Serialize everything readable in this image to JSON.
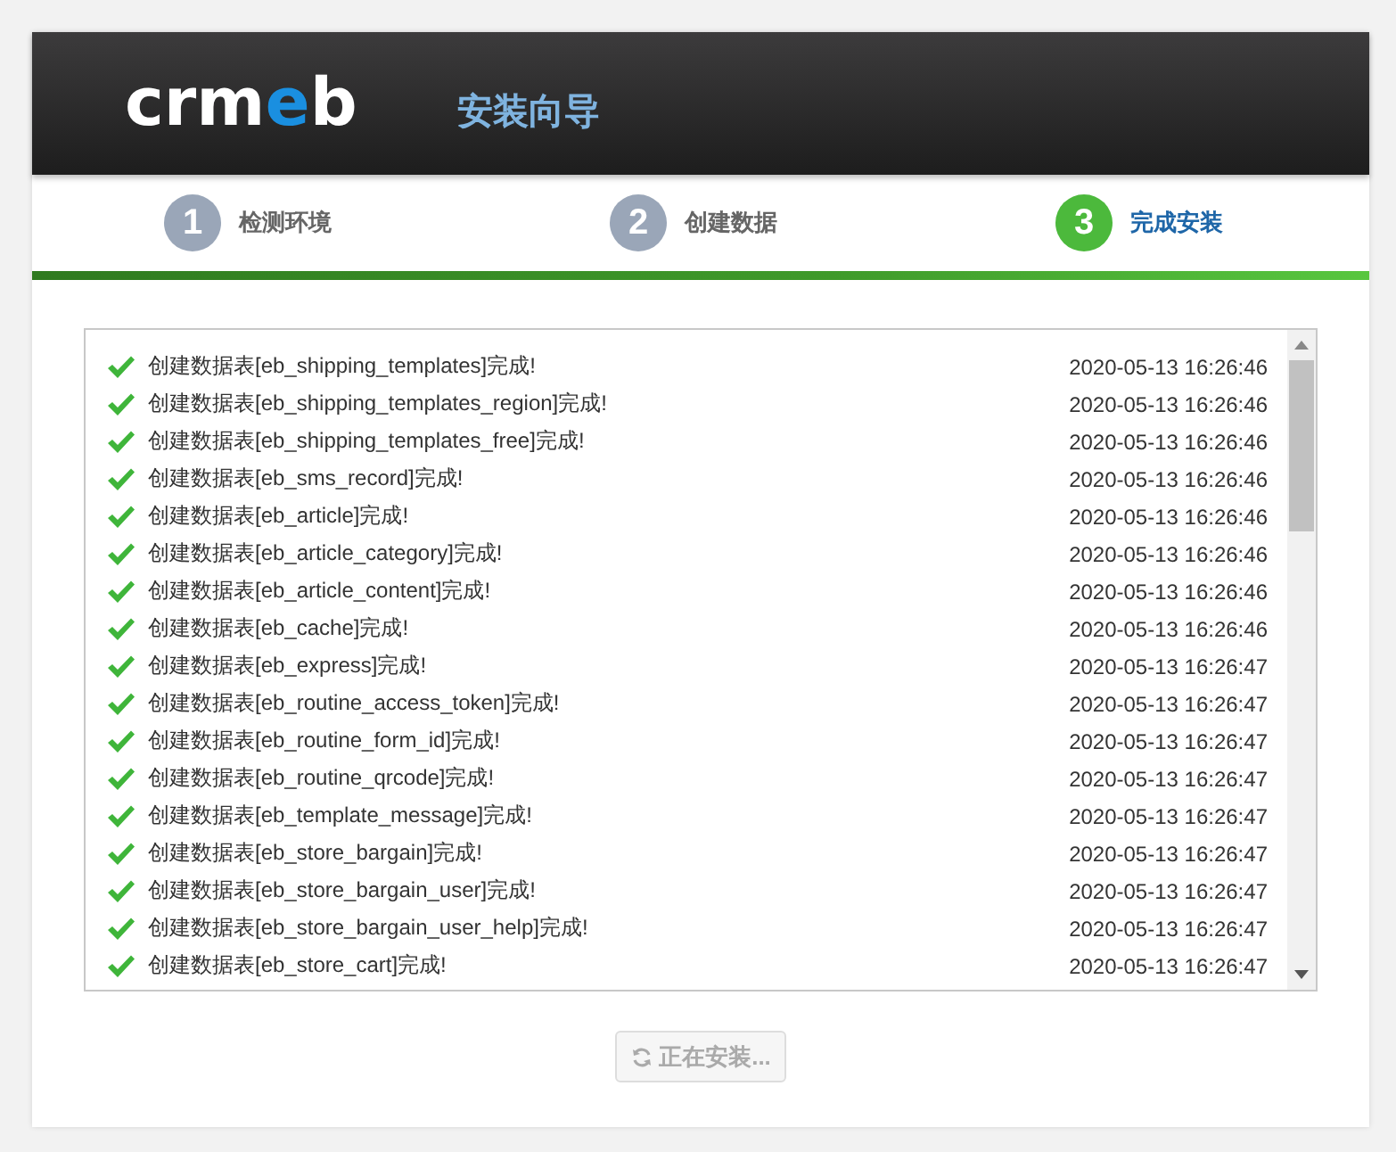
{
  "header": {
    "logo": [
      {
        "text": "crm",
        "accent": false
      },
      {
        "text": "e",
        "accent": true
      },
      {
        "text": "b",
        "accent": false
      }
    ],
    "title": "安装向导"
  },
  "steps": [
    {
      "number": "1",
      "label": "检测环境",
      "selected": false
    },
    {
      "number": "2",
      "label": "创建数据",
      "selected": false
    },
    {
      "number": "3",
      "label": "完成安装",
      "selected": true
    }
  ],
  "progress": {
    "level": 1
  },
  "log": [
    {
      "message": "创建数据表[eb_shipping_templates]完成!",
      "time": "2020-05-13 16:26:46"
    },
    {
      "message": "创建数据表[eb_shipping_templates_region]完成!",
      "time": "2020-05-13 16:26:46"
    },
    {
      "message": "创建数据表[eb_shipping_templates_free]完成!",
      "time": "2020-05-13 16:26:46"
    },
    {
      "message": "创建数据表[eb_sms_record]完成!",
      "time": "2020-05-13 16:26:46"
    },
    {
      "message": "创建数据表[eb_article]完成!",
      "time": "2020-05-13 16:26:46"
    },
    {
      "message": "创建数据表[eb_article_category]完成!",
      "time": "2020-05-13 16:26:46"
    },
    {
      "message": "创建数据表[eb_article_content]完成!",
      "time": "2020-05-13 16:26:46"
    },
    {
      "message": "创建数据表[eb_cache]完成!",
      "time": "2020-05-13 16:26:46"
    },
    {
      "message": "创建数据表[eb_express]完成!",
      "time": "2020-05-13 16:26:47"
    },
    {
      "message": "创建数据表[eb_routine_access_token]完成!",
      "time": "2020-05-13 16:26:47"
    },
    {
      "message": "创建数据表[eb_routine_form_id]完成!",
      "time": "2020-05-13 16:26:47"
    },
    {
      "message": "创建数据表[eb_routine_qrcode]完成!",
      "time": "2020-05-13 16:26:47"
    },
    {
      "message": "创建数据表[eb_template_message]完成!",
      "time": "2020-05-13 16:26:47"
    },
    {
      "message": "创建数据表[eb_store_bargain]完成!",
      "time": "2020-05-13 16:26:47"
    },
    {
      "message": "创建数据表[eb_store_bargain_user]完成!",
      "time": "2020-05-13 16:26:47"
    },
    {
      "message": "创建数据表[eb_store_bargain_user_help]完成!",
      "time": "2020-05-13 16:26:47"
    },
    {
      "message": "创建数据表[eb_store_cart]完成!",
      "time": "2020-05-13 16:26:47"
    }
  ],
  "button": {
    "label": "正在安装...",
    "disabled": true
  }
}
